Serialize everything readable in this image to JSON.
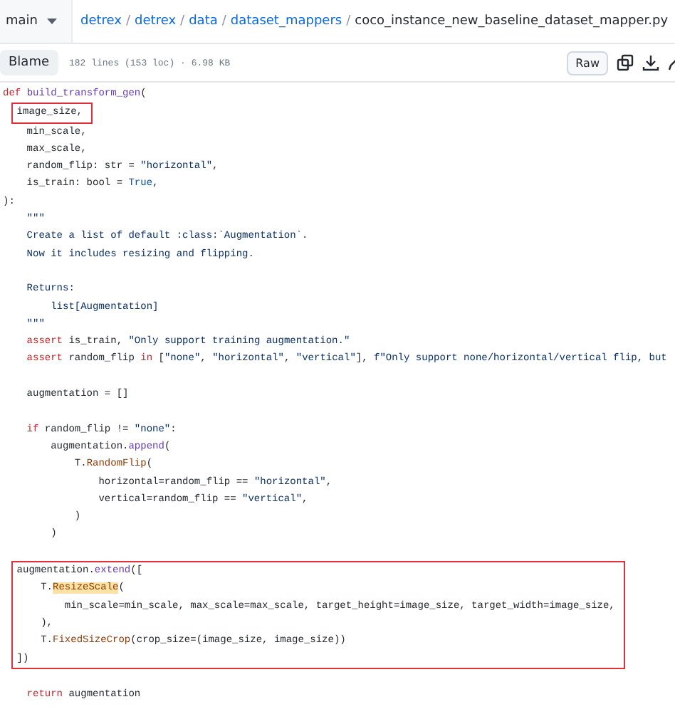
{
  "header": {
    "branch": "main",
    "breadcrumb": [
      {
        "label": "detrex",
        "current": false
      },
      {
        "label": "detrex",
        "current": false
      },
      {
        "label": "data",
        "current": false
      },
      {
        "label": "dataset_mappers",
        "current": false
      },
      {
        "label": "coco_instance_new_baseline_dataset_mapper.py",
        "current": true
      }
    ],
    "separator": "/"
  },
  "toolbar": {
    "view_button": "Blame",
    "file_info": "182 lines (153 loc) · 6.98 KB",
    "raw_button": "Raw"
  },
  "code": {
    "blocks": [
      {
        "boxed": false,
        "lines": [
          {
            "kind": "code",
            "segments": [
              {
                "t": "def ",
                "kind": "keyword"
              },
              {
                "t": "build_transform_gen",
                "kind": "func"
              },
              {
                "t": "(",
                "kind": "plain"
              }
            ]
          }
        ]
      },
      {
        "boxed": true,
        "lines": [
          {
            "kind": "code",
            "segments": [
              {
                "t": "    image_size,",
                "kind": "plain"
              }
            ]
          }
        ]
      },
      {
        "boxed": false,
        "lines": [
          {
            "kind": "code",
            "segments": [
              {
                "t": "    min_scale,",
                "kind": "plain"
              }
            ]
          },
          {
            "kind": "code",
            "segments": [
              {
                "t": "    max_scale,",
                "kind": "plain"
              }
            ]
          },
          {
            "kind": "code",
            "segments": [
              {
                "t": "    random_flip: str = ",
                "kind": "plain"
              },
              {
                "t": "\"horizontal\"",
                "kind": "string"
              },
              {
                "t": ",",
                "kind": "plain"
              }
            ]
          },
          {
            "kind": "code",
            "segments": [
              {
                "t": "    is_train: bool = ",
                "kind": "plain"
              },
              {
                "t": "True",
                "kind": "const"
              },
              {
                "t": ",",
                "kind": "plain"
              }
            ]
          },
          {
            "kind": "code",
            "segments": [
              {
                "t": "):",
                "kind": "plain"
              }
            ]
          },
          {
            "kind": "code",
            "segments": [
              {
                "t": "    \"\"\"",
                "kind": "string"
              }
            ]
          },
          {
            "kind": "code",
            "segments": [
              {
                "t": "    Create a list of default :class:`Augmentation`.",
                "kind": "string"
              }
            ]
          },
          {
            "kind": "code",
            "segments": [
              {
                "t": "    Now it includes resizing and flipping.",
                "kind": "string"
              }
            ]
          },
          {
            "kind": "blank"
          },
          {
            "kind": "code",
            "segments": [
              {
                "t": "    Returns:",
                "kind": "string"
              }
            ]
          },
          {
            "kind": "code",
            "segments": [
              {
                "t": "        list[Augmentation]",
                "kind": "string"
              }
            ]
          },
          {
            "kind": "code",
            "segments": [
              {
                "t": "    \"\"\"",
                "kind": "string"
              }
            ]
          },
          {
            "kind": "code",
            "segments": [
              {
                "t": "    assert ",
                "kind": "keyword"
              },
              {
                "t": "is_train, ",
                "kind": "plain"
              },
              {
                "t": "\"Only support training augmentation.\"",
                "kind": "string"
              }
            ]
          },
          {
            "kind": "code",
            "segments": [
              {
                "t": "    assert ",
                "kind": "keyword"
              },
              {
                "t": "random_flip ",
                "kind": "plain"
              },
              {
                "t": "in ",
                "kind": "keyword"
              },
              {
                "t": "[",
                "kind": "plain"
              },
              {
                "t": "\"none\"",
                "kind": "string"
              },
              {
                "t": ", ",
                "kind": "plain"
              },
              {
                "t": "\"horizontal\"",
                "kind": "string"
              },
              {
                "t": ", ",
                "kind": "plain"
              },
              {
                "t": "\"vertical\"",
                "kind": "string"
              },
              {
                "t": "], ",
                "kind": "plain"
              },
              {
                "t": "f\"Only support none/horizontal/vertical flip, but",
                "kind": "string"
              }
            ]
          },
          {
            "kind": "blank"
          },
          {
            "kind": "code",
            "segments": [
              {
                "t": "    augmentation = []",
                "kind": "plain"
              }
            ]
          },
          {
            "kind": "blank"
          },
          {
            "kind": "code",
            "segments": [
              {
                "t": "    if ",
                "kind": "keyword"
              },
              {
                "t": "random_flip != ",
                "kind": "plain"
              },
              {
                "t": "\"none\"",
                "kind": "string"
              },
              {
                "t": ":",
                "kind": "plain"
              }
            ]
          },
          {
            "kind": "code",
            "segments": [
              {
                "t": "        augmentation.",
                "kind": "plain"
              },
              {
                "t": "append",
                "kind": "method"
              },
              {
                "t": "(",
                "kind": "plain"
              }
            ]
          },
          {
            "kind": "code",
            "segments": [
              {
                "t": "            T.",
                "kind": "plain"
              },
              {
                "t": "RandomFlip",
                "kind": "class"
              },
              {
                "t": "(",
                "kind": "plain"
              }
            ]
          },
          {
            "kind": "code",
            "segments": [
              {
                "t": "                horizontal=random_flip == ",
                "kind": "plain"
              },
              {
                "t": "\"horizontal\"",
                "kind": "string"
              },
              {
                "t": ",",
                "kind": "plain"
              }
            ]
          },
          {
            "kind": "code",
            "segments": [
              {
                "t": "                vertical=random_flip == ",
                "kind": "plain"
              },
              {
                "t": "\"vertical\"",
                "kind": "string"
              },
              {
                "t": ",",
                "kind": "plain"
              }
            ]
          },
          {
            "kind": "code",
            "segments": [
              {
                "t": "            )",
                "kind": "plain"
              }
            ]
          },
          {
            "kind": "code",
            "segments": [
              {
                "t": "        )",
                "kind": "plain"
              }
            ]
          },
          {
            "kind": "blank"
          }
        ]
      },
      {
        "boxed": true,
        "lines": [
          {
            "kind": "code",
            "segments": [
              {
                "t": "    augmentation.",
                "kind": "plain"
              },
              {
                "t": "extend",
                "kind": "method"
              },
              {
                "t": "([",
                "kind": "plain"
              }
            ]
          },
          {
            "kind": "code",
            "segments": [
              {
                "t": "        T.",
                "kind": "plain"
              },
              {
                "t": "ResizeScale",
                "kind": "match"
              },
              {
                "t": "(",
                "kind": "plain"
              }
            ]
          },
          {
            "kind": "code",
            "segments": [
              {
                "t": "            min_scale=min_scale, max_scale=max_scale, target_height=image_size, target_width=image_size,",
                "kind": "plain"
              }
            ]
          },
          {
            "kind": "code",
            "segments": [
              {
                "t": "        ),",
                "kind": "plain"
              }
            ]
          },
          {
            "kind": "code",
            "segments": [
              {
                "t": "        T.",
                "kind": "plain"
              },
              {
                "t": "FixedSizeCrop",
                "kind": "class"
              },
              {
                "t": "(crop_size=(image_size, image_size))",
                "kind": "plain"
              }
            ]
          },
          {
            "kind": "code",
            "segments": [
              {
                "t": "    ])",
                "kind": "plain"
              }
            ]
          }
        ]
      },
      {
        "boxed": false,
        "lines": [
          {
            "kind": "blank"
          },
          {
            "kind": "code",
            "segments": [
              {
                "t": "    return ",
                "kind": "keyword"
              },
              {
                "t": "augmentation",
                "kind": "plain"
              }
            ]
          }
        ]
      }
    ]
  }
}
